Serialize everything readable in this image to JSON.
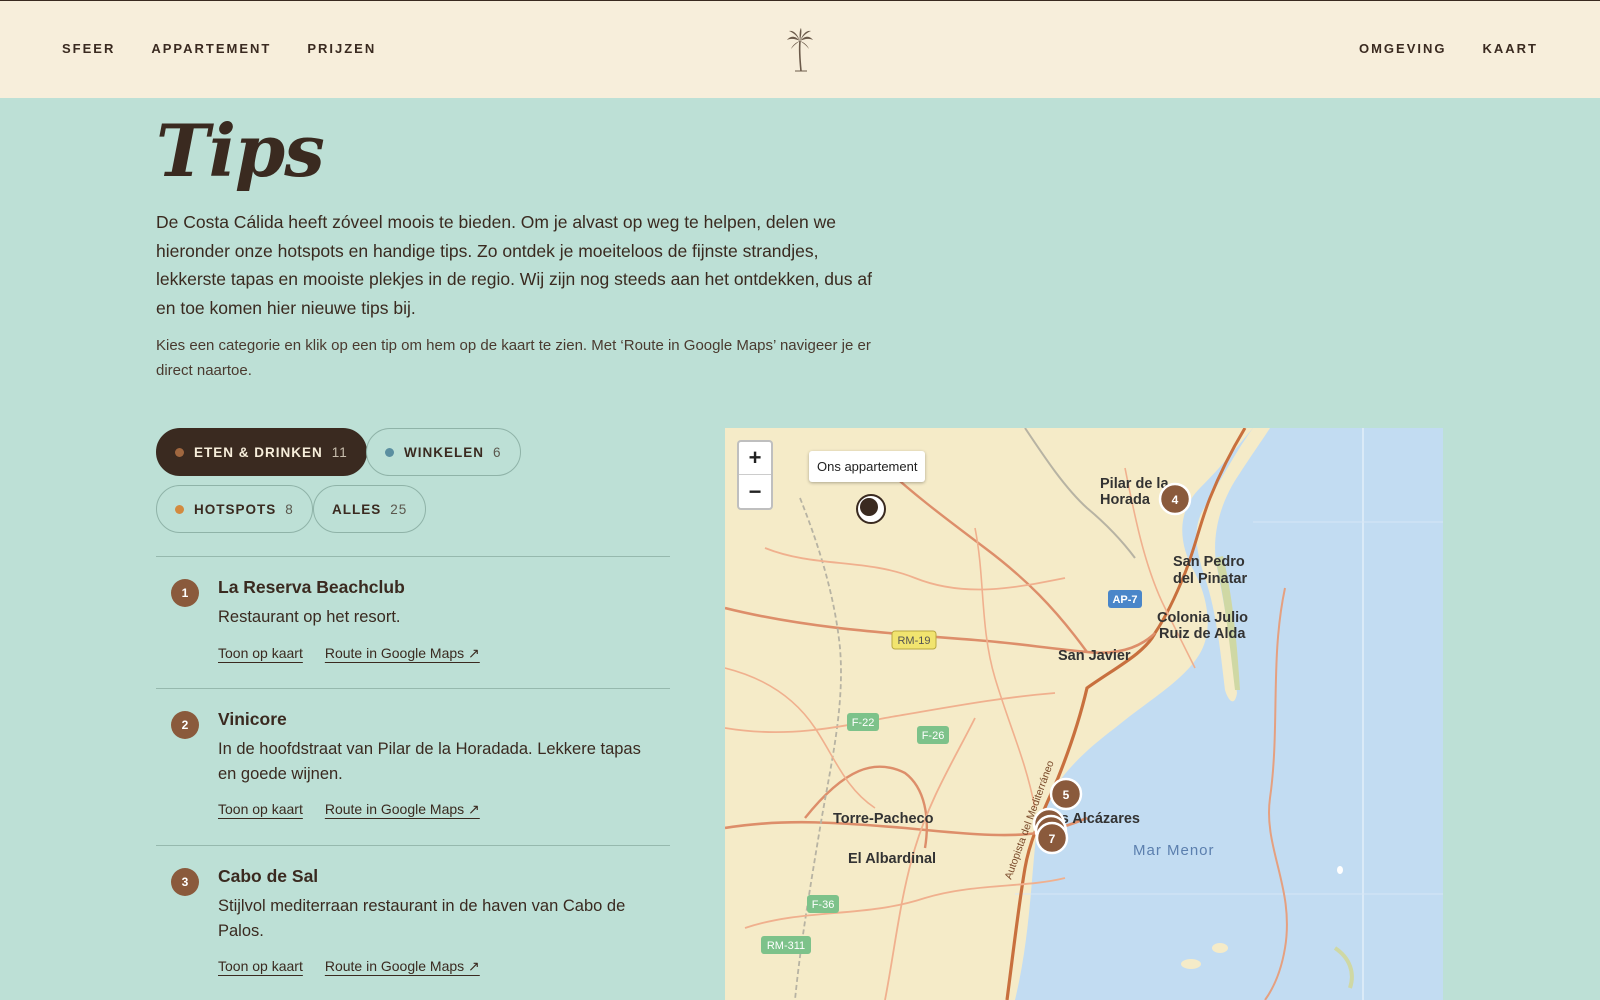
{
  "nav": {
    "left": [
      "SFEER",
      "APPARTEMENT",
      "PRIJZEN"
    ],
    "right": [
      "OMGEVING",
      "KAART"
    ]
  },
  "logo": {
    "icon": "palm-tree-icon"
  },
  "page": {
    "title": "Tips",
    "intro": "De Costa Cálida heeft zóveel moois te bieden. Om je alvast op weg te helpen, delen we hieronder onze hotspots en handige tips. Zo ontdek je moeiteloos de fijnste strandjes, lekkerste tapas en mooiste plekjes in de regio. Wij zijn nog steeds aan het ontdekken, dus af en toe komen hier nieuwe tips bij.",
    "hint": "Kies een categorie en klik op een tip om hem op de kaart te zien. Met ‘Route in Google Maps’ navigeer je er direct naartoe."
  },
  "filters": [
    {
      "label": "ETEN & DRINKEN",
      "count": "11",
      "color": "#a0673f",
      "active": true
    },
    {
      "label": "WINKELEN",
      "count": "6",
      "color": "#5b8fa0",
      "active": false
    },
    {
      "label": "HOTSPOTS",
      "count": "8",
      "color": "#d38a3f",
      "active": false
    },
    {
      "label": "ALLES",
      "count": "25",
      "color": "",
      "active": false
    }
  ],
  "tips": [
    {
      "num": "1",
      "name": "La Reserva Beachclub",
      "desc": "Restaurant op het resort.",
      "show": "Toon op kaart",
      "route": "Route in Google Maps ↗"
    },
    {
      "num": "2",
      "name": "Vinicore",
      "desc": "In de hoofdstraat van Pilar de la Horadada. Lekkere tapas en goede wijnen.",
      "show": "Toon op kaart",
      "route": "Route in Google Maps ↗"
    },
    {
      "num": "3",
      "name": "Cabo de Sal",
      "desc": "Stijlvol mediterraan restaurant in de haven van Cabo de Palos.",
      "show": "Toon op kaart",
      "route": "Route in Google Maps ↗"
    }
  ],
  "map": {
    "zoom_in": "+",
    "zoom_out": "−",
    "tooltip": "Ons appartement",
    "places": [
      "Pilar de la",
      "Horada",
      "San Pedro",
      "del Pinatar",
      "Colonia Julio",
      "Ruiz de Alda",
      "San Javier",
      "Torre-Pacheco",
      "El Albardinal",
      "Los Alcázares",
      "Mar Menor"
    ],
    "roads": [
      "AP-7",
      "RM-19",
      "F-22",
      "F-26",
      "F-36",
      "RM-311",
      "Autopista del Mediterráneo"
    ],
    "markers": [
      "4",
      "5",
      "7"
    ],
    "marker_color": "#8a5a3c",
    "sea_color": "#c2dcf2",
    "land_color": "#f5ebc8"
  }
}
